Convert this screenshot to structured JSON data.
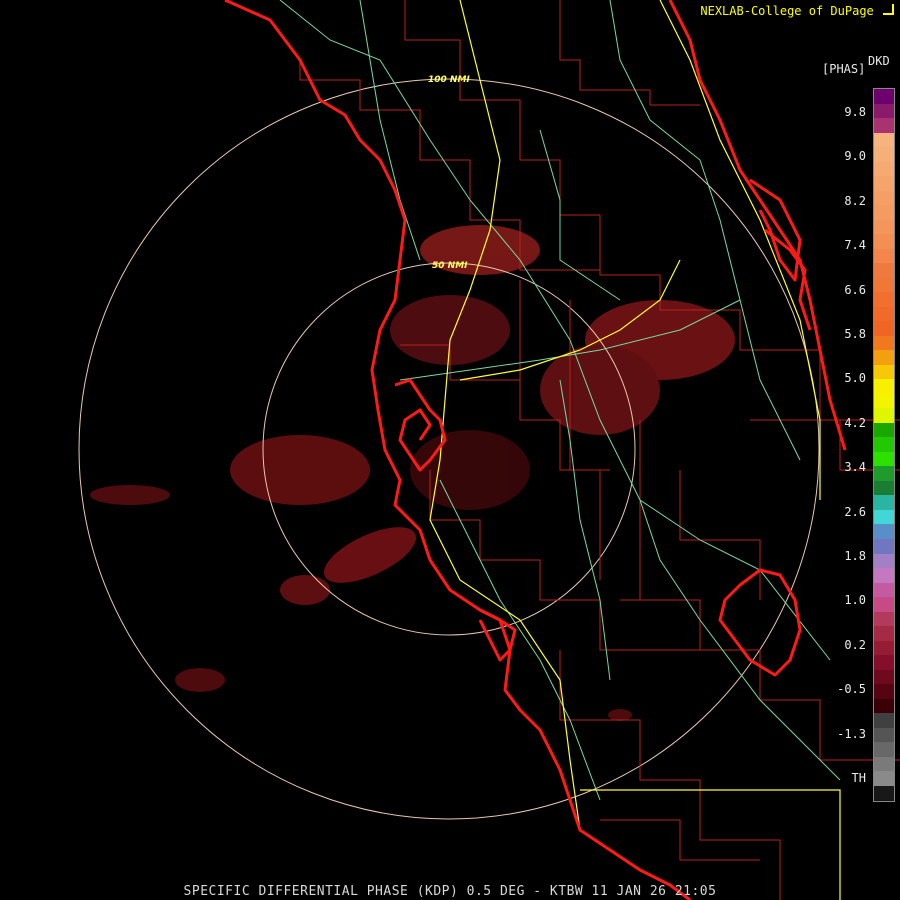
{
  "header": {
    "credit": "NEXLAB-College of DuPage",
    "product_units_left": "[PHAS]",
    "product_units_right": "DKD"
  },
  "footer": {
    "caption": "SPECIFIC DIFFERENTIAL PHASE (KDP) 0.5 DEG - KTBW 11 JAN 26 21:05"
  },
  "range_rings": [
    {
      "label": "100 NMI"
    },
    {
      "label": "50 NMI"
    }
  ],
  "colorbar": {
    "tick_labels": [
      "9.8",
      "9.0",
      "8.2",
      "7.4",
      "6.6",
      "5.8",
      "5.0",
      "4.2",
      "3.4",
      "2.6",
      "1.8",
      "1.0",
      "0.2",
      "-0.5",
      "-1.3",
      "TH"
    ],
    "colors_top_to_bottom": [
      "#6d006d",
      "#8a1a6a",
      "#a8336e",
      "#f4b37f",
      "#f5b07a",
      "#f5aa72",
      "#f5a46c",
      "#f59f66",
      "#f59a60",
      "#f4955a",
      "#f38f53",
      "#f4864c",
      "#ef7a3f",
      "#f07736",
      "#f17030",
      "#f26a2a",
      "#ef6524",
      "#f0781e",
      "#f3a010",
      "#f6c807",
      "#f9ef00",
      "#f4f400",
      "#e0f500",
      "#1aa800",
      "#22c800",
      "#2ce000",
      "#1e9b2a",
      "#1b7d34",
      "#2ab5a0",
      "#42d6d6",
      "#5a8ec8",
      "#7077c0",
      "#a37fc3",
      "#c478c0",
      "#c45aa0",
      "#c64a84",
      "#b33a5c",
      "#a52b44",
      "#961c34",
      "#850f2a",
      "#6e0a1c",
      "#560412",
      "#3a0008",
      "#404040",
      "#555555",
      "#686868",
      "#7a7a7a",
      "#8a8a8a",
      "#181818"
    ]
  },
  "colors": {
    "coastline": "#ff1a1a",
    "county_lines": "#b8221c",
    "highways": "#ffff33",
    "roads": "#79d9a0",
    "range_ring": "#e8c8b0",
    "echo": "#7a1216"
  }
}
